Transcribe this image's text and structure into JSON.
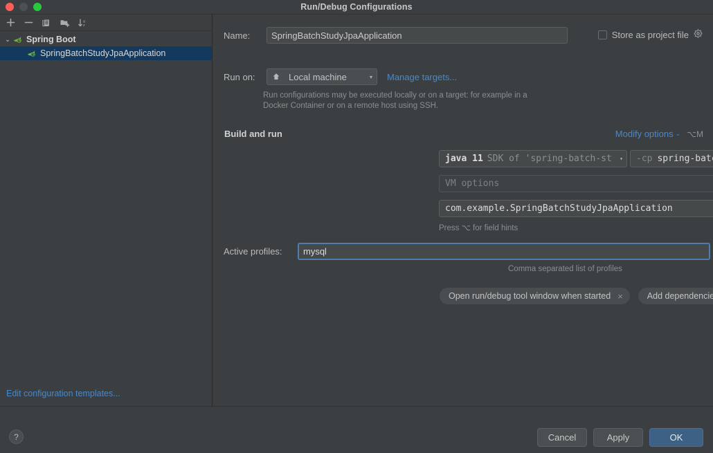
{
  "window": {
    "title": "Run/Debug Configurations",
    "traffic_lights": [
      "close-button",
      "minimize-button",
      "zoom-button"
    ]
  },
  "sidebar": {
    "toolbar": [
      {
        "name": "add-configuration-button",
        "icon": "plus-icon",
        "label": "+"
      },
      {
        "name": "remove-configuration-button",
        "icon": "minus-icon",
        "label": "−"
      },
      {
        "name": "copy-configuration-button",
        "icon": "copy-icon",
        "label": "Copy"
      },
      {
        "name": "save-configuration-button",
        "icon": "folder-add-icon",
        "label": "Save configuration"
      },
      {
        "name": "sort-configurations-button",
        "icon": "sort-alphabetically-icon",
        "label": "Sort"
      }
    ],
    "tree": {
      "group": {
        "label": "Spring Boot",
        "icon": "spring-boot-icon",
        "expanded": true,
        "chevron": "⌄"
      },
      "children": [
        {
          "label": "SpringBatchStudyJpaApplication",
          "icon": "spring-boot-icon",
          "selected": true
        }
      ]
    },
    "edit_templates_link": "Edit configuration templates..."
  },
  "main": {
    "name": {
      "label": "Name:",
      "value": "SpringBatchStudyJpaApplication"
    },
    "store_as_project_file": {
      "label": "Store as project file",
      "checked": false,
      "gear_icon": "gear-icon"
    },
    "run_on": {
      "label": "Run on:",
      "value": "Local machine",
      "icon": "local-machine-icon",
      "caret": "▾",
      "manage_targets_link": "Manage targets..."
    },
    "run_on_hint": "Run configurations may be executed locally or on a target: for example in a Docker Container or on a remote host using SSH.",
    "build_and_run": {
      "section_title": "Build and run",
      "modify_options_link": "Modify options",
      "modify_options_caret": "⌄",
      "modify_options_shortcut": "⌥M",
      "jdk": {
        "name_bright": "java 11",
        "name_dim": "SDK of 'spring-batch-st",
        "caret": "▾"
      },
      "classpath": {
        "flag": "-cp",
        "module": "spring-batch-study-jpa.main",
        "caret": "▾"
      },
      "vm_options": {
        "placeholder": "VM options",
        "value": "",
        "icons": [
          "macro-list-icon",
          "expand-icon"
        ]
      },
      "main_class": {
        "value": "com.example.SpringBatchStudyJpaApplication",
        "icon": "macro-list-icon"
      },
      "field_hint": "Press ⌥ for field hints"
    },
    "active_profiles": {
      "label": "Active profiles:",
      "value": "mysql",
      "focused": true,
      "hint": "Comma separated list of profiles"
    },
    "chips": [
      {
        "label": "Open run/debug tool window when started",
        "close": "×"
      },
      {
        "label": "Add dependencies with “provided” scope to classpath",
        "close": "×"
      }
    ]
  },
  "footer": {
    "help_button": "?",
    "buttons": [
      {
        "label": "Cancel",
        "primary": false
      },
      {
        "label": "Apply",
        "primary": false
      },
      {
        "label": "OK",
        "primary": true
      }
    ]
  },
  "colors": {
    "window_bg": "#3c3f41",
    "field_bg": "#45494a",
    "link": "#4a88c7",
    "selection": "#133a5e",
    "focus_border": "#4d7ead",
    "primary_button": "#3d6185",
    "spring_green": "#6db33f"
  }
}
